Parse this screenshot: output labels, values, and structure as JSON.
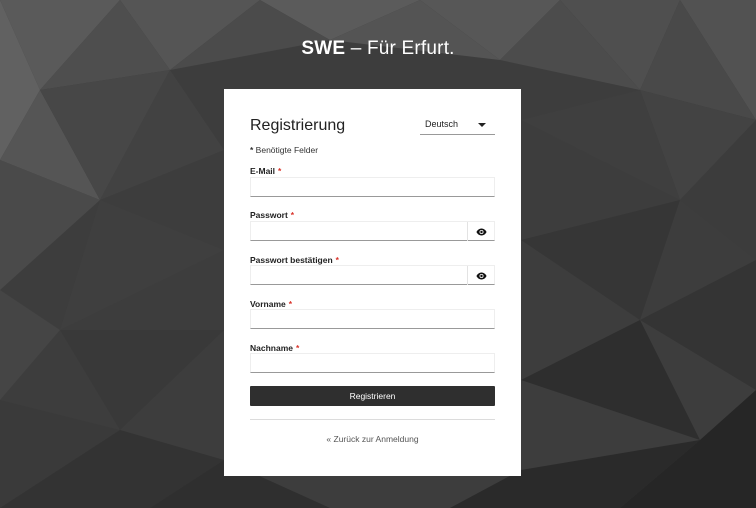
{
  "brand": {
    "name": "SWE",
    "tagline": " – Für Erfurt."
  },
  "form": {
    "title": "Registrierung",
    "language": {
      "selected": "Deutsch"
    },
    "required_note": {
      "marker": "*",
      "text": " Benötigte Felder"
    },
    "fields": [
      {
        "label": "E-Mail",
        "required_marker": "*",
        "value": ""
      },
      {
        "label": "Passwort",
        "required_marker": "*",
        "value": ""
      },
      {
        "label": "Passwort bestätigen",
        "required_marker": "*",
        "value": ""
      },
      {
        "label": "Vorname",
        "required_marker": "*",
        "value": ""
      },
      {
        "label": "Nachname",
        "required_marker": "*",
        "value": ""
      }
    ],
    "submit_label": "Registrieren",
    "back_link": "« Zurück zur Anmeldung"
  },
  "colors": {
    "background": "#3b3b3b",
    "card": "#ffffff",
    "button": "#2f2f2f",
    "required": "#d9342b"
  },
  "icons": {
    "password_toggle": "eye-icon"
  }
}
